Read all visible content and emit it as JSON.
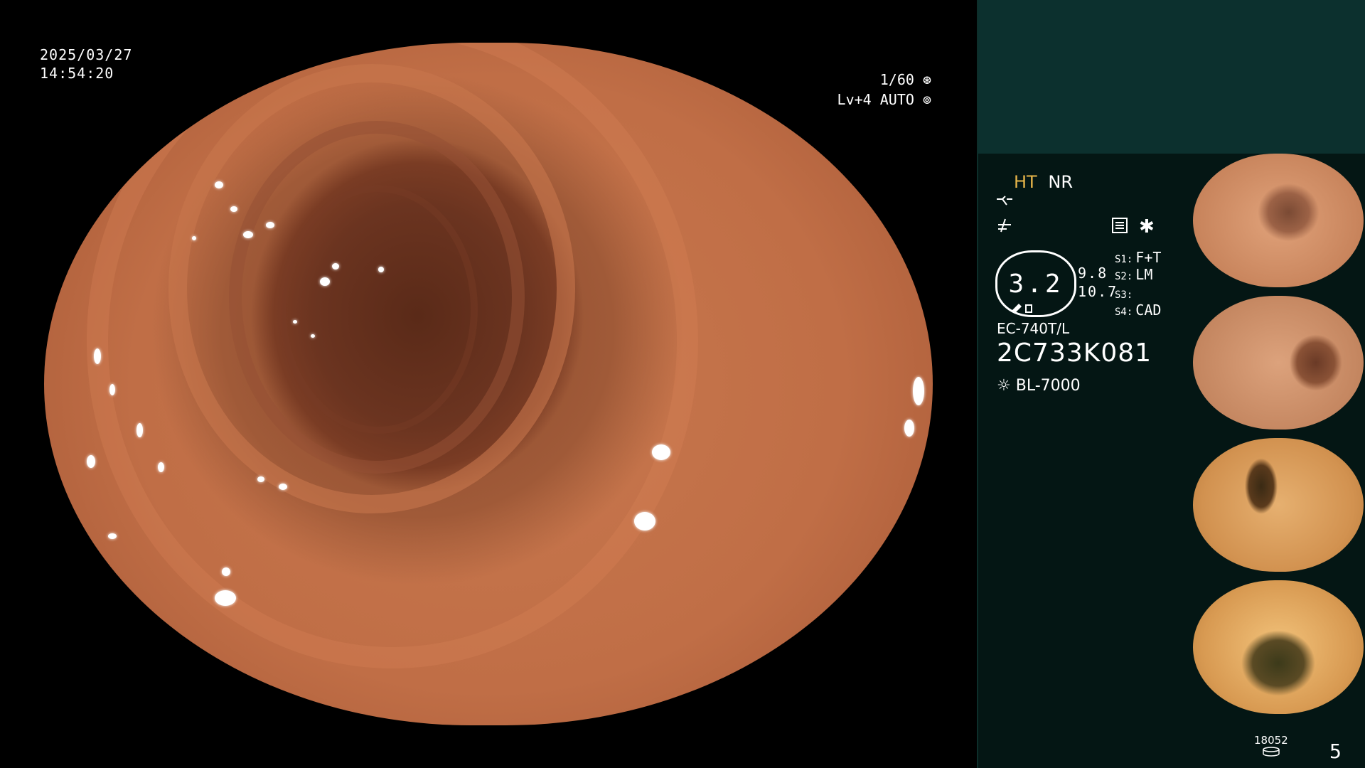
{
  "overlay": {
    "date": "2025/03/27",
    "time": "14:54:20",
    "shutter": "1/60",
    "shutter_icon": "shutter-icon",
    "level": "Lv+4 AUTO",
    "level_icon": "iris-icon"
  },
  "panel": {
    "mode_primary": "HT",
    "mode_secondary": "NR",
    "icons": [
      "enhance-icon",
      "structure-icon",
      "menu-icon",
      "asterisk-icon"
    ],
    "gauge_value": "3.2",
    "readings": [
      "9.8",
      "10.7"
    ],
    "slots": [
      {
        "key": "S1:",
        "value": "F+T"
      },
      {
        "key": "S2:",
        "value": "LM"
      },
      {
        "key": "S3:",
        "value": ""
      },
      {
        "key": "S4:",
        "value": "CAD"
      }
    ],
    "scope_model": "EC-740T/L",
    "scope_serial": "2C733K081",
    "light_source": "BL-7000",
    "light_icon": "light-source-icon",
    "disk_count": "18052",
    "disk_icon": "storage-disk-icon",
    "page_number": "5",
    "colors": {
      "panel": "#041614",
      "panel_top": "#0c302e",
      "highlight": "#e8b64a"
    }
  },
  "thumbnails": [
    {
      "name": "capture-1"
    },
    {
      "name": "capture-2"
    },
    {
      "name": "capture-3"
    },
    {
      "name": "capture-4"
    }
  ]
}
